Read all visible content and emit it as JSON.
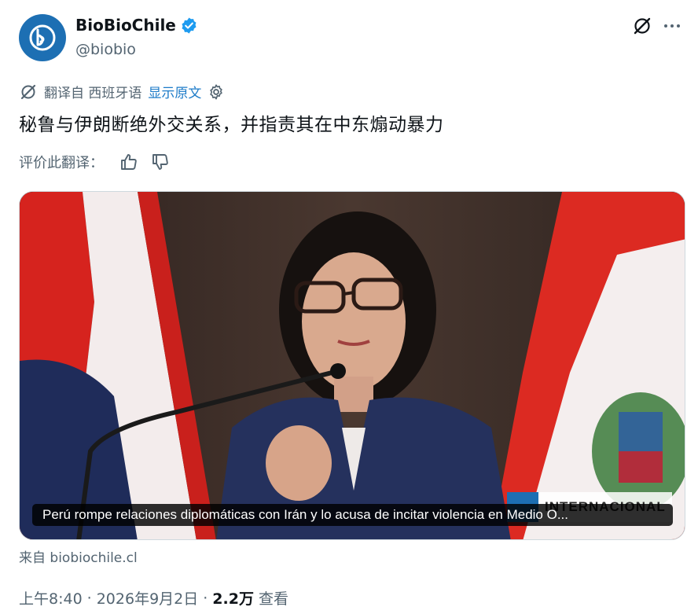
{
  "author": {
    "display_name": "BioBioChile",
    "handle": "@biobio",
    "verified_icon": "verified-badge-icon",
    "avatar_icon": "biobio-logo-icon",
    "brand_color": "#1d6fb3"
  },
  "translation": {
    "translated_from": "翻译自 西班牙语",
    "show_original": "显示原文",
    "rate_label": "评价此翻译："
  },
  "tweet": {
    "text": "秘鲁与伊朗断绝外交关系，并指责其在中东煽动暴力"
  },
  "media": {
    "caption": "Perú rompe relaciones diplomáticas con Irán y lo acusa de incitar violencia en Medio O...",
    "watermark": "INTERNACIONAL"
  },
  "card": {
    "from_label": "来自",
    "domain": "biobiochile.cl"
  },
  "meta": {
    "time": "上午8:40",
    "date": "2026年9月2日",
    "views_count": "2.2万",
    "views_label": "查看"
  },
  "colors": {
    "link": "#1d7bc8",
    "secondary_text": "#536471",
    "primary_text": "#0f1419"
  }
}
